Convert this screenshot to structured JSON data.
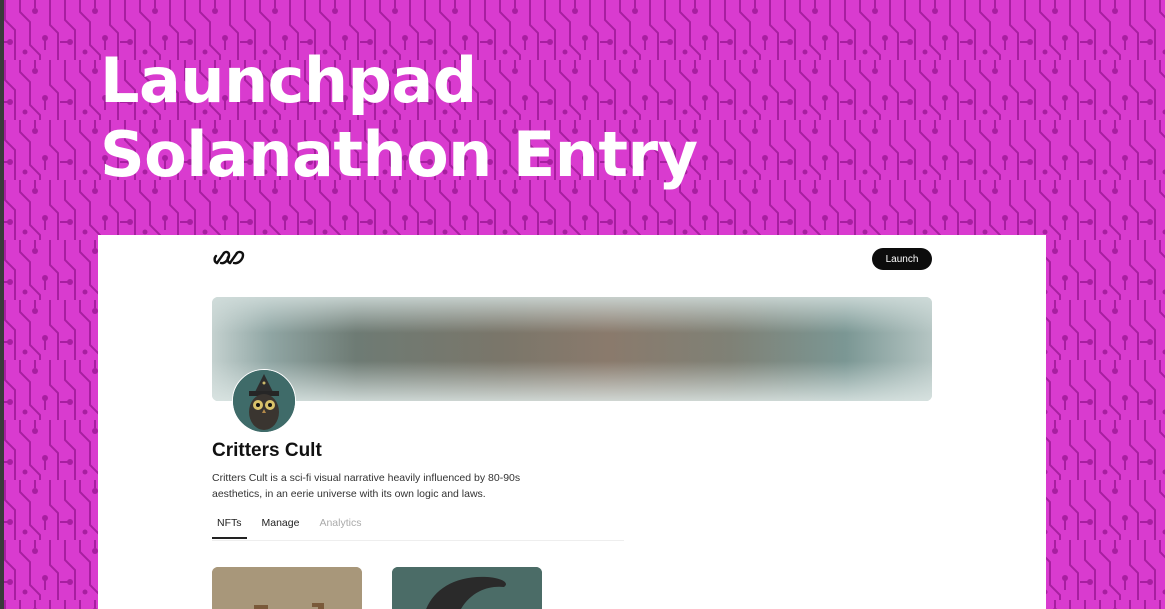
{
  "slide": {
    "title_line1": "Launchpad",
    "title_line2": "Solanathon Entry"
  },
  "header": {
    "logo": "infinity-logo-icon",
    "launch_label": "Launch"
  },
  "collection": {
    "name": "Critters Cult",
    "description": "Critters Cult is a sci-fi visual narrative heavily influenced by 80-90s aesthetics, in an eerie universe with its own logic and laws."
  },
  "tabs": [
    {
      "label": "NFTs",
      "state": "active"
    },
    {
      "label": "Manage",
      "state": "normal"
    },
    {
      "label": "Analytics",
      "state": "disabled"
    }
  ],
  "colors": {
    "background": "#d93bcf",
    "circuit": "#a71fa0",
    "launch_button": "#0c0c0c"
  }
}
